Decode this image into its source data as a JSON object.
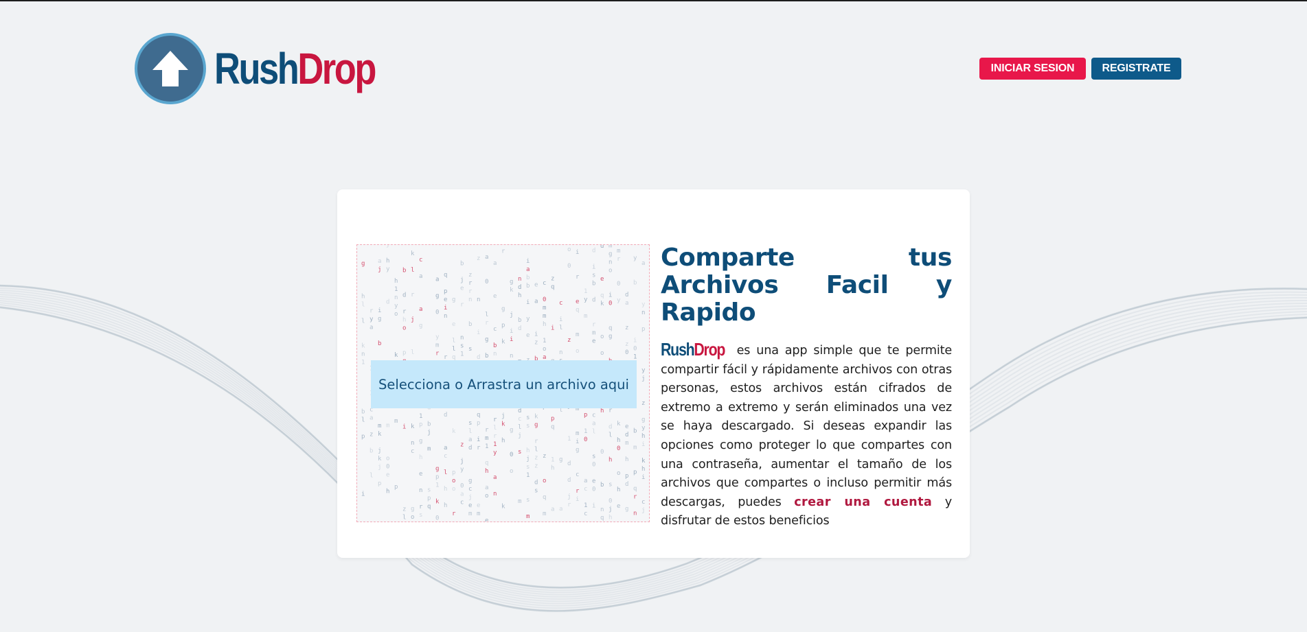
{
  "header": {
    "logo": {
      "part1": "Rush",
      "part2": "Drop"
    },
    "nav": {
      "login_label": "INICIAR SESION",
      "register_label": "REGISTRATE"
    }
  },
  "uploader": {
    "label": "Selecciona o Arrastra un archivo aqui"
  },
  "main": {
    "title": "Comparte tus Archivos Facil y Rapido",
    "intro_logo": {
      "part1": "Rush",
      "part2": "Drop"
    },
    "description_part1": " es una app simple que te permite compartir fácil y rápidamente archivos con otras personas, estos archivos están cifrados de extremo a extremo y serán eliminados una vez se haya descargado. Si deseas expandir las opciones como proteger lo que compartes con una contraseña, aumentar el tamaño de los archivos que compartes o incluso permitir más descargas, puedes ",
    "cta_link": "crear una cuenta",
    "description_part2": " y disfrutar de estos beneficios"
  },
  "colors": {
    "brand_blue": "#0e4d78",
    "brand_red": "#c8163f",
    "login_button": "#e8174a",
    "register_button": "#0e5a8a",
    "dropzone_highlight": "#c5e8fb"
  },
  "icons": {
    "logo_icon": "up-arrow-icon"
  }
}
